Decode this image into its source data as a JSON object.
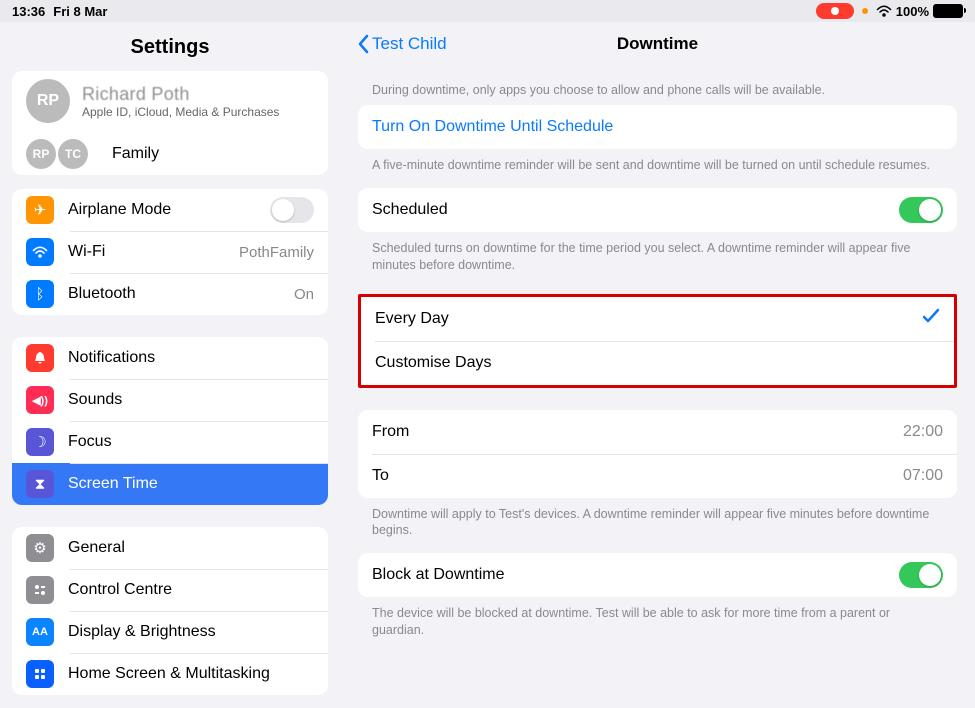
{
  "status": {
    "time": "13:36",
    "date": "Fri 8 Mar",
    "battery": "100%"
  },
  "sidebar": {
    "title": "Settings",
    "user": {
      "initials": "RP",
      "name": "Richard Poth",
      "sub": "Apple ID, iCloud, Media & Purchases"
    },
    "family": {
      "label": "Family",
      "a1": "RP",
      "a2": "TC"
    },
    "net": {
      "airplane": "Airplane Mode",
      "wifi": "Wi-Fi",
      "wifi_val": "PothFamily",
      "bt": "Bluetooth",
      "bt_val": "On"
    },
    "g2": {
      "notif": "Notifications",
      "sounds": "Sounds",
      "focus": "Focus",
      "screentime": "Screen Time"
    },
    "g3": {
      "general": "General",
      "control": "Control Centre",
      "display": "Display & Brightness",
      "home": "Home Screen & Multitasking"
    }
  },
  "detail": {
    "back": "Test Child",
    "title": "Downtime",
    "intro": "During downtime, only apps you choose to allow and phone calls will be available.",
    "turn_on": "Turn On Downtime Until Schedule",
    "turn_on_foot": "A five-minute downtime reminder will be sent and downtime will be turned on until schedule resumes.",
    "scheduled": "Scheduled",
    "scheduled_foot": "Scheduled turns on downtime for the time period you select. A downtime reminder will appear five minutes before downtime.",
    "every_day": "Every Day",
    "custom_days": "Customise Days",
    "from": "From",
    "from_val": "22:00",
    "to": "To",
    "to_val": "07:00",
    "time_foot": "Downtime will apply to Test's devices. A downtime reminder will appear five minutes before downtime begins.",
    "block": "Block at Downtime",
    "block_foot": "The device will be blocked at downtime. Test will be able to ask for more time from a parent or guardian."
  }
}
